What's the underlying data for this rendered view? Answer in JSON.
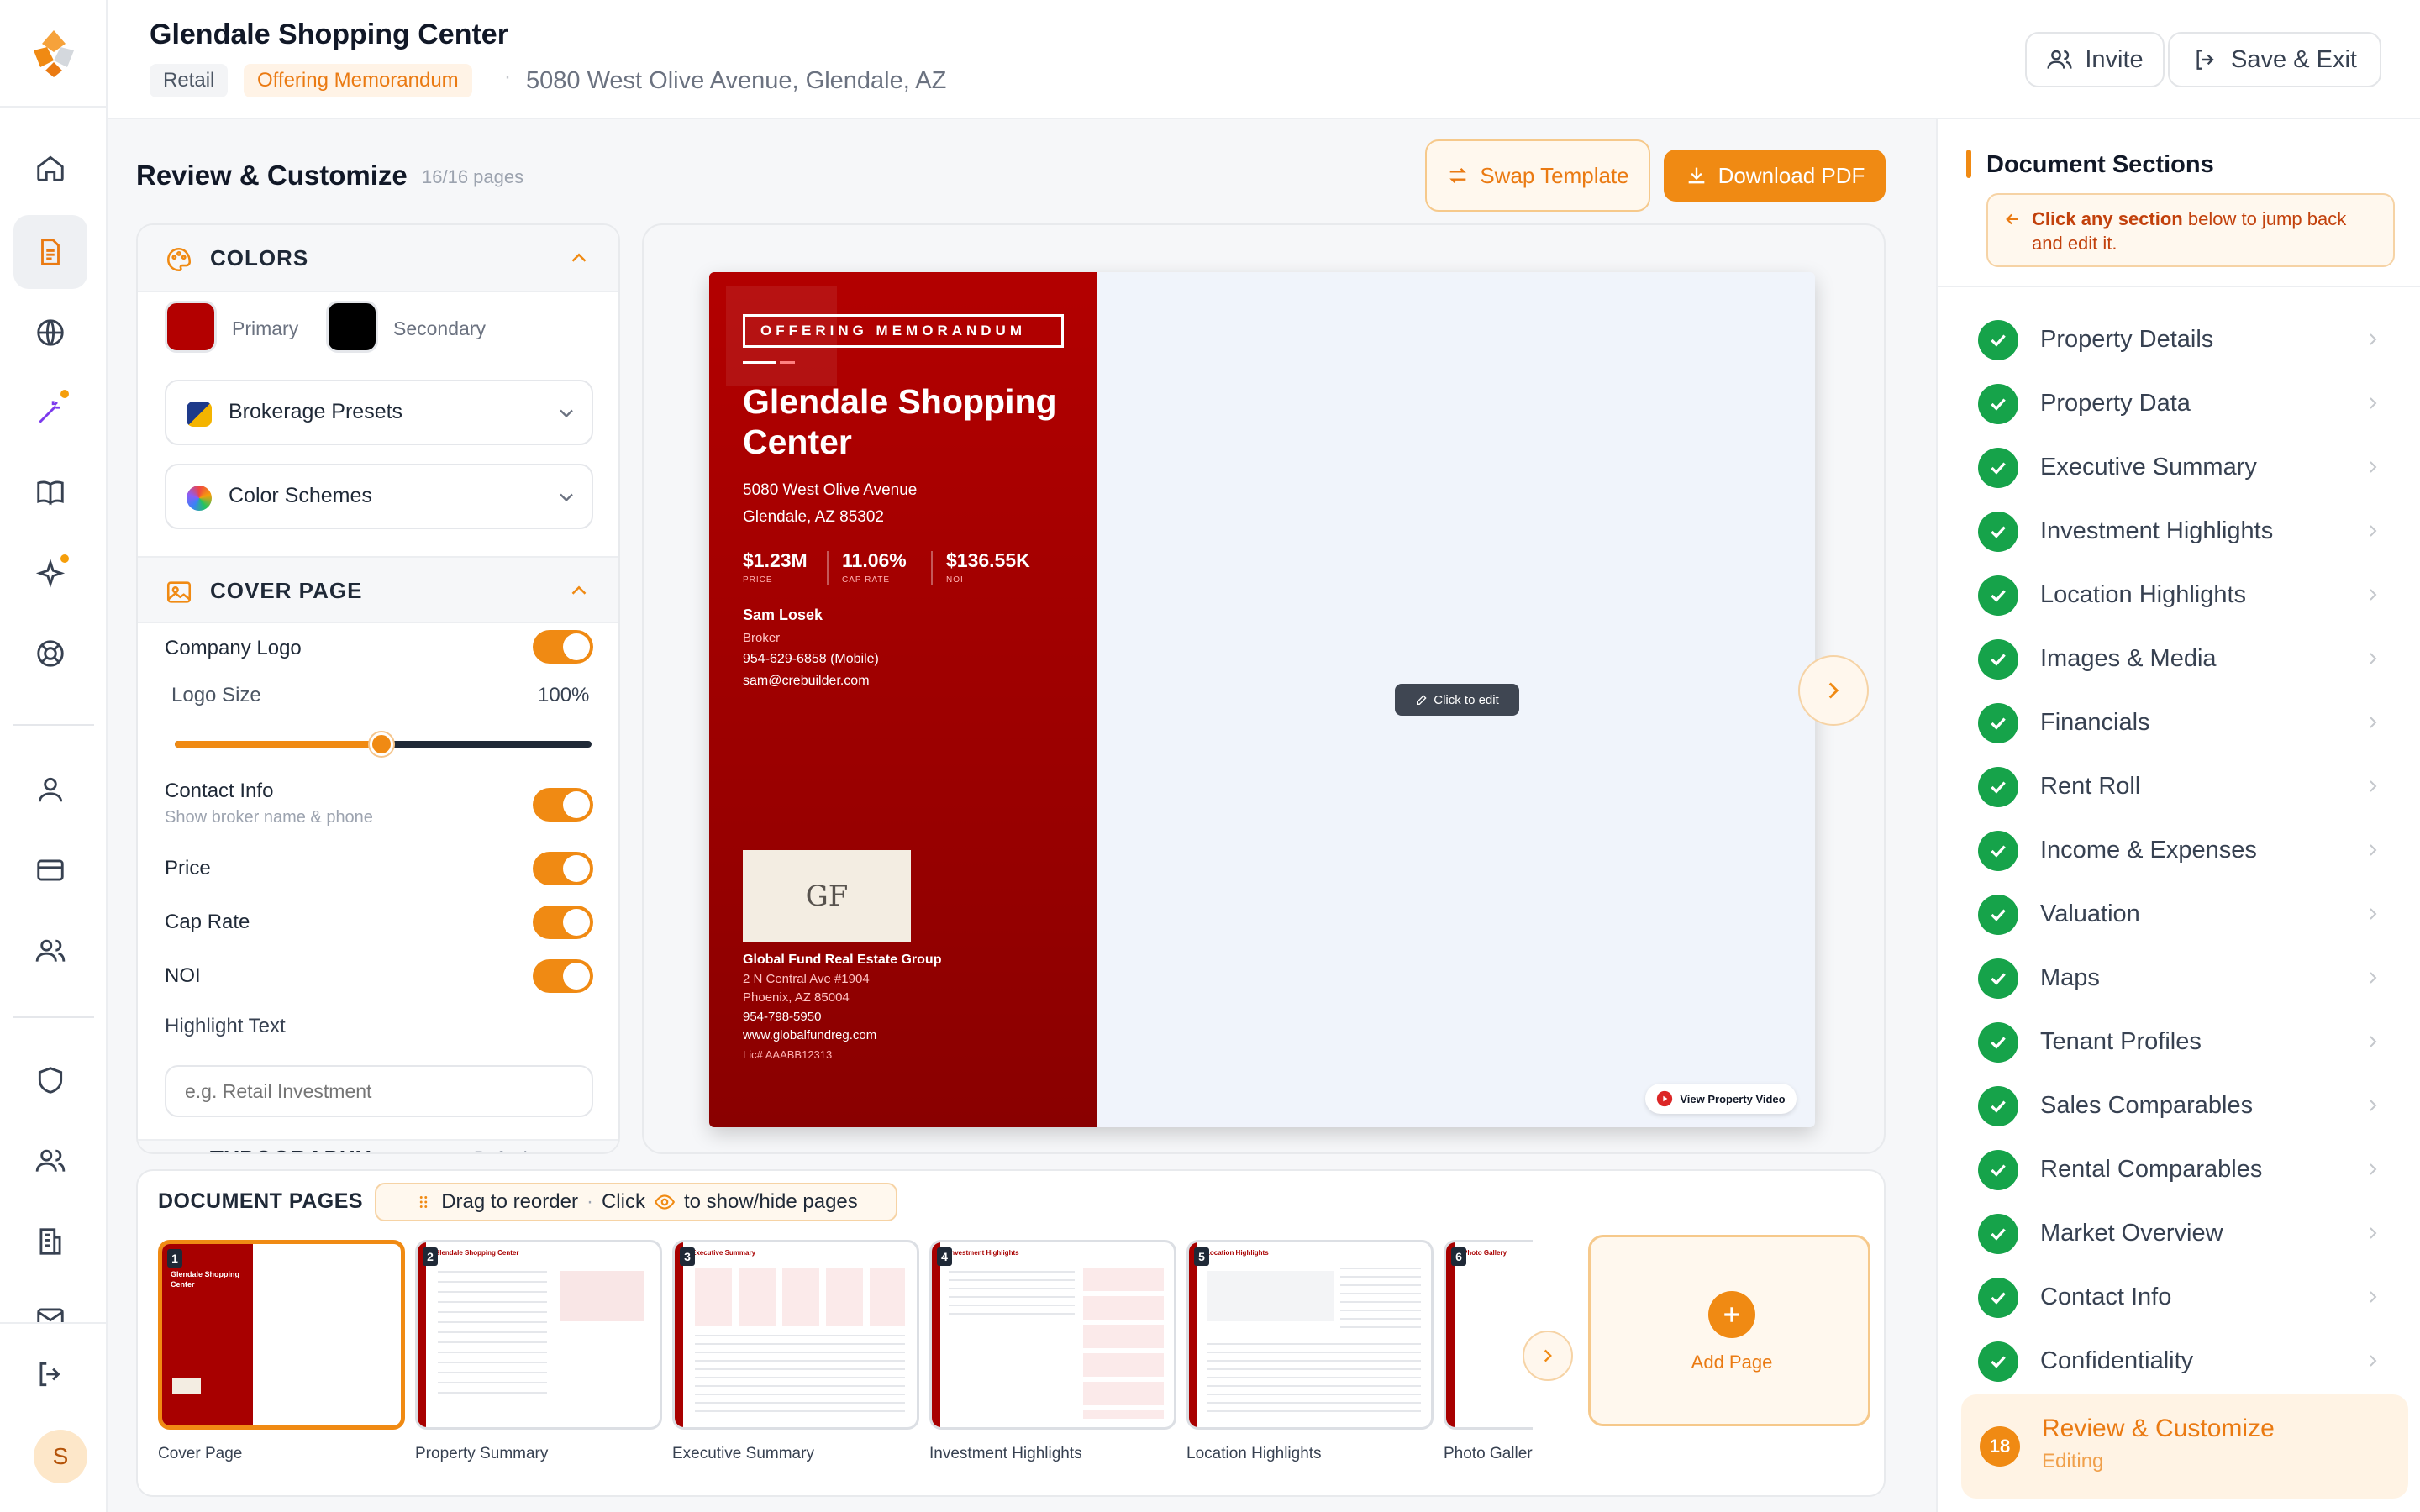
{
  "app": {
    "title": "Glendale Shopping Center",
    "tags": [
      "Retail",
      "Offering Memorandum"
    ],
    "address": "5080 West Olive Avenue, Glendale, AZ",
    "separator": "·",
    "invite_label": "Invite",
    "save_exit_label": "Save & Exit",
    "avatar_initial": "S",
    "accent_color": "#f08a13"
  },
  "review": {
    "title": "Review & Customize",
    "pages_count": "16/16 pages",
    "swap_template_label": "Swap Template",
    "download_pdf_label": "Download PDF"
  },
  "customize": {
    "colors_heading": "COLORS",
    "primary_label": "Primary",
    "primary_color": "#b30000",
    "secondary_label": "Secondary",
    "secondary_color": "#000000",
    "brokerage_presets_label": "Brokerage Presets",
    "color_schemes_label": "Color Schemes",
    "cover_heading": "COVER PAGE",
    "company_logo_label": "Company Logo",
    "company_logo_on": true,
    "logo_size_label": "Logo Size",
    "logo_size_value": "100%",
    "logo_size_fraction": 0.5,
    "contact_info_label": "Contact Info",
    "contact_info_sub": "Show broker name & phone",
    "contact_info_on": true,
    "price_label": "Price",
    "price_on": true,
    "cap_rate_label": "Cap Rate",
    "cap_rate_on": true,
    "noi_label": "NOI",
    "noi_on": true,
    "highlight_text_label": "Highlight Text",
    "highlight_placeholder": "e.g. Retail Investment",
    "typography_heading": "TYPOGRAPHY",
    "typography_value": "Default"
  },
  "cover": {
    "badge": "OFFERING MEMORANDUM",
    "title": "Glendale Shopping Center",
    "address_line1": "5080 West Olive Avenue",
    "address_line2": "Glendale, AZ 85302",
    "stats": [
      {
        "value": "$1.23M",
        "label": "PRICE"
      },
      {
        "value": "11.06%",
        "label": "CAP RATE"
      },
      {
        "value": "$136.55K",
        "label": "NOI"
      }
    ],
    "broker_name": "Sam Losek",
    "broker_role": "Broker",
    "broker_phone": "954-629-6858 (Mobile)",
    "broker_email": "sam@crebuilder.com",
    "logo_initials": "GF",
    "firm_name": "Global Fund Real Estate Group",
    "firm_addr1": "2 N Central Ave #1904",
    "firm_addr2": "Phoenix, AZ 85004",
    "firm_phone": "954-798-5950",
    "firm_web": "www.globalfundreg.com",
    "firm_license": "Lic# AAABB12313",
    "click_to_edit": "Click to edit",
    "view_video": "View Property Video"
  },
  "pages": {
    "heading": "DOCUMENT PAGES",
    "hint_drag": "Drag to reorder",
    "hint_sep": "·",
    "hint_click": "Click",
    "hint_toggle": "to show/hide pages",
    "add_page": "Add Page",
    "items": [
      {
        "num": "1",
        "label": "Cover Page",
        "head": "OFFERING MEMORANDUM"
      },
      {
        "num": "2",
        "label": "Property Summary",
        "head": "Glendale Shopping Center"
      },
      {
        "num": "3",
        "label": "Executive Summary",
        "head": "Executive Summary"
      },
      {
        "num": "4",
        "label": "Investment Highlights",
        "head": "Investment Highlights"
      },
      {
        "num": "5",
        "label": "Location Highlights",
        "head": "Location Highlights"
      },
      {
        "num": "6",
        "label": "Photo Gallery",
        "head": "Photo Gallery"
      }
    ]
  },
  "sections": {
    "title": "Document Sections",
    "note_bold": "Click any section",
    "note_rest": "below to jump back and edit it.",
    "items": [
      "Property Details",
      "Property Data",
      "Executive Summary",
      "Investment Highlights",
      "Location Highlights",
      "Images & Media",
      "Financials",
      "Rent Roll",
      "Income & Expenses",
      "Valuation",
      "Maps",
      "Tenant Profiles",
      "Sales Comparables",
      "Rental Comparables",
      "Market Overview",
      "Contact Info",
      "Confidentiality"
    ],
    "active_number": "18",
    "active_label": "Review & Customize",
    "active_status": "Editing"
  }
}
